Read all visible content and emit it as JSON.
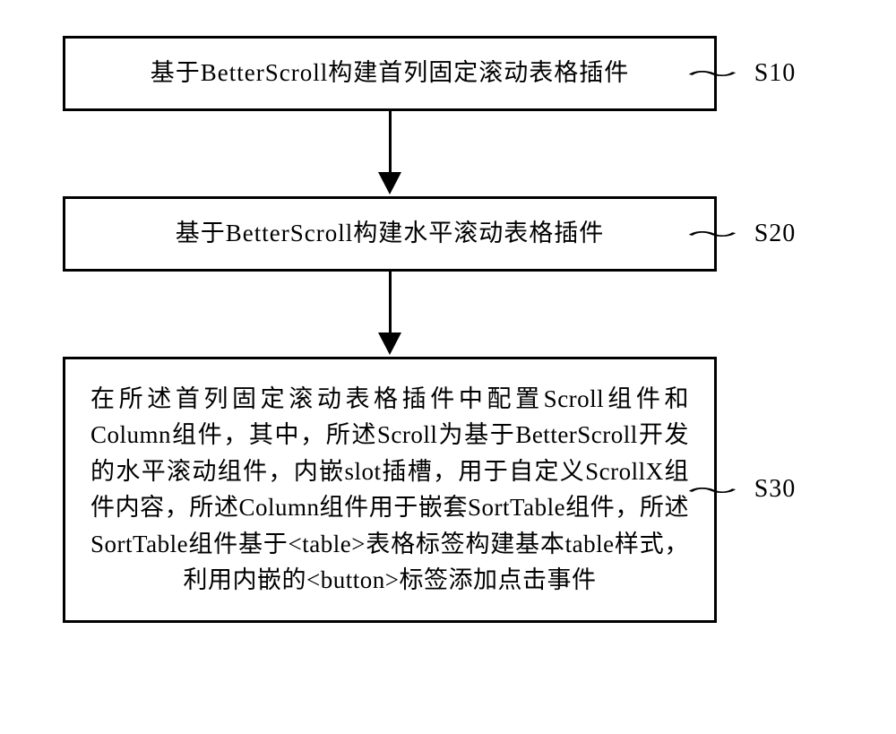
{
  "flowchart": {
    "steps": [
      {
        "id": "S10",
        "text": "基于BetterScroll构建首列固定滚动表格插件"
      },
      {
        "id": "S20",
        "text": "基于BetterScroll构建水平滚动表格插件"
      },
      {
        "id": "S30",
        "text": "在所述首列固定滚动表格插件中配置Scroll组件和Column组件，其中，所述Scroll为基于BetterScroll开发的水平滚动组件，内嵌slot插槽，用于自定义ScrollX组件内容，所述Column组件用于嵌套SortTable组件，所述SortTable组件基于<table>表格标签构建基本table样式，利用内嵌的<button>标签添加点击事件"
      }
    ]
  }
}
